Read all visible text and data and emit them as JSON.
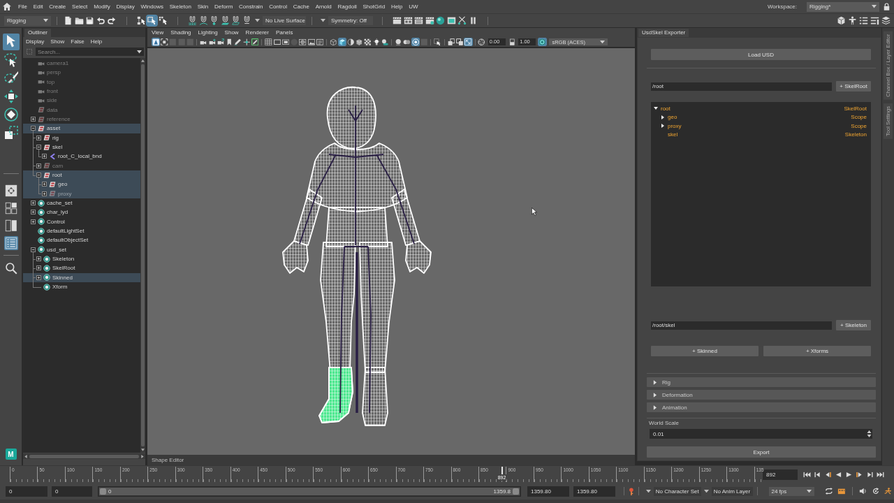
{
  "menu_bar": {
    "items": [
      "File",
      "Edit",
      "Create",
      "Select",
      "Modify",
      "Display",
      "Windows",
      "Skeleton",
      "Skin",
      "Deform",
      "Constrain",
      "Control",
      "Cache",
      "Arnold",
      "Ragdoll",
      "ShotGrid",
      "Help",
      "UW"
    ],
    "workspace_label": "Workspace:",
    "workspace": "Rigging*"
  },
  "status_line": {
    "menu_set": "Rigging",
    "file_tools": [
      {
        "kind": "file",
        "on": false
      },
      {
        "kind": "folder",
        "on": false
      },
      {
        "kind": "save",
        "on": false
      },
      {
        "kind": "undo",
        "on": false
      },
      {
        "kind": "redo",
        "on": false
      }
    ],
    "select_modes": [
      {
        "kind": "hierarchy",
        "on": false
      },
      {
        "kind": "object",
        "on": true
      },
      {
        "kind": "component",
        "on": false
      }
    ],
    "snap_tools": [
      {
        "kind": "snapgrid",
        "on": false
      },
      {
        "kind": "snapcurve",
        "on": false
      },
      {
        "kind": "snappoint",
        "on": false
      },
      {
        "kind": "snapplane",
        "on": false
      },
      {
        "kind": "snaplive",
        "on": false
      },
      {
        "kind": "magnet",
        "on": false
      }
    ],
    "live_surface": "No Live Surface",
    "symmetry": "Symmetry: Off",
    "render_tools": [
      {
        "kind": "clapper",
        "on": false
      },
      {
        "kind": "sequence",
        "on": false
      },
      {
        "kind": "ipr",
        "on": false
      },
      {
        "kind": "rendersettings",
        "on": false
      },
      {
        "kind": "sphere",
        "on": false
      },
      {
        "kind": "renderview",
        "on": false
      },
      {
        "kind": "scissors",
        "on": false
      },
      {
        "kind": "pause",
        "on": false
      }
    ],
    "panel_tools": [
      {
        "kind": "toolkit"
      },
      {
        "kind": "figure"
      },
      {
        "kind": "outline"
      },
      {
        "kind": "editor"
      },
      {
        "kind": "layers"
      }
    ]
  },
  "toolbox": {
    "tools": [
      {
        "kind": "select",
        "selected": true
      },
      {
        "kind": "lasso",
        "selected": false
      },
      {
        "kind": "paint",
        "selected": false
      },
      {
        "kind": "move",
        "selected": false
      },
      {
        "kind": "rotate",
        "selected": false
      },
      {
        "kind": "scale",
        "selected": false
      }
    ],
    "layouts": [
      {
        "kind": "single",
        "selected": false
      },
      {
        "kind": "quad",
        "selected": false
      },
      {
        "kind": "split",
        "selected": false
      },
      {
        "kind": "outlinerlayout",
        "selected": true
      }
    ],
    "badge": "M"
  },
  "outliner": {
    "tab": "Outliner",
    "menus": [
      "Display",
      "Show",
      "False",
      "Help"
    ],
    "search": {
      "placeholder": "Search..."
    },
    "items": [
      {
        "label": "camera1",
        "kind": "camera",
        "hidden": true,
        "selected": false
      },
      {
        "label": "persp",
        "kind": "camera",
        "hidden": true,
        "selected": false
      },
      {
        "label": "top",
        "kind": "camera",
        "hidden": true,
        "selected": false
      },
      {
        "label": "front",
        "kind": "camera",
        "hidden": true,
        "selected": false
      },
      {
        "label": "side",
        "kind": "camera",
        "hidden": true,
        "selected": false
      },
      {
        "label": "data",
        "kind": "group",
        "hidden": true,
        "selected": false
      },
      {
        "label": "reference",
        "kind": "group",
        "hidden": true,
        "selected": false,
        "expanded": false
      },
      {
        "label": "asset",
        "kind": "group",
        "hidden": false,
        "selected": true,
        "expanded": true,
        "children": [
          {
            "label": "rig",
            "kind": "group",
            "hidden": false,
            "selected": false,
            "expanded": false
          },
          {
            "label": "skel",
            "kind": "group",
            "hidden": false,
            "selected": false,
            "expanded": true,
            "children": [
              {
                "label": "root_C_local_bnd",
                "kind": "joint",
                "hidden": false,
                "selected": false,
                "expanded": false
              }
            ]
          },
          {
            "label": "cam",
            "kind": "group",
            "hidden": true,
            "selected": false,
            "expanded": false
          },
          {
            "label": "root",
            "kind": "group",
            "hidden": false,
            "selected": true,
            "expanded": true,
            "children": [
              {
                "label": "geo",
                "kind": "group",
                "hidden": false,
                "selected": true,
                "expanded": false
              },
              {
                "label": "proxy",
                "kind": "group",
                "hidden": true,
                "selected": true,
                "expanded": false
              }
            ]
          }
        ]
      },
      {
        "label": "cache_set",
        "kind": "set",
        "hidden": false,
        "selected": false,
        "expanded": false
      },
      {
        "label": "char_lyd",
        "kind": "set",
        "hidden": false,
        "selected": false,
        "expanded": false
      },
      {
        "label": "Control",
        "kind": "set",
        "hidden": false,
        "selected": false,
        "expanded": false
      },
      {
        "label": "defaultLightSet",
        "kind": "set",
        "hidden": false,
        "selected": false
      },
      {
        "label": "defaultObjectSet",
        "kind": "set",
        "hidden": false,
        "selected": false
      },
      {
        "label": "usd_set",
        "kind": "set",
        "hidden": false,
        "selected": false,
        "expanded": true,
        "children": [
          {
            "label": "Skeleton",
            "kind": "set",
            "hidden": false,
            "selected": false,
            "expanded": false
          },
          {
            "label": "SkelRoot",
            "kind": "set",
            "hidden": false,
            "selected": false,
            "expanded": false
          },
          {
            "label": "Skinned",
            "kind": "set",
            "hidden": false,
            "selected": true,
            "expanded": false
          },
          {
            "label": "Xform",
            "kind": "set",
            "hidden": false,
            "selected": false
          }
        ]
      }
    ]
  },
  "viewport": {
    "menus": [
      "View",
      "Shading",
      "Lighting",
      "Show",
      "Renderer",
      "Panels"
    ],
    "tool_groups": [
      [
        {
          "kind": "tile",
          "on": true,
          "disabled": false
        },
        {
          "kind": "framecorners",
          "on": false,
          "disabled": false
        },
        {
          "kind": "square",
          "on": false,
          "disabled": true
        },
        {
          "kind": "square",
          "on": false,
          "disabled": true
        },
        {
          "kind": "square",
          "on": false,
          "disabled": true
        }
      ],
      [
        {
          "kind": "camera",
          "on": false,
          "disabled": false
        },
        {
          "kind": "cameraplus",
          "on": false,
          "disabled": false
        },
        {
          "kind": "cameraarrow",
          "on": false,
          "disabled": false
        },
        {
          "kind": "bookmark",
          "on": false,
          "disabled": false
        },
        {
          "kind": "pen",
          "on": false,
          "disabled": false
        },
        {
          "kind": "axes",
          "on": false,
          "disabled": false
        },
        {
          "kind": "pencil",
          "on": false,
          "disabled": false
        }
      ],
      [
        {
          "kind": "grid",
          "on": false,
          "disabled": false
        },
        {
          "kind": "filmgate",
          "on": false,
          "disabled": false
        },
        {
          "kind": "resgate",
          "on": false,
          "disabled": false
        },
        {
          "kind": "circle",
          "on": false,
          "disabled": true
        },
        {
          "kind": "fieldchart",
          "on": false,
          "disabled": false
        },
        {
          "kind": "imageplane",
          "on": false,
          "disabled": false
        },
        {
          "kind": "titlesafe",
          "on": false,
          "disabled": false
        }
      ],
      [
        {
          "kind": "wirecube",
          "on": false,
          "disabled": false
        },
        {
          "kind": "shadedcube",
          "on": true,
          "disabled": false
        },
        {
          "kind": "halfcircle",
          "on": false,
          "disabled": false
        },
        {
          "kind": "texcube",
          "on": false,
          "disabled": false
        },
        {
          "kind": "checker",
          "on": false,
          "disabled": false
        },
        {
          "kind": "bulb",
          "on": false,
          "disabled": false
        },
        {
          "kind": "shadow",
          "on": false,
          "disabled": false
        }
      ],
      [
        {
          "kind": "ball",
          "on": false,
          "disabled": false
        },
        {
          "kind": "balls",
          "on": false,
          "disabled": false
        },
        {
          "kind": "target",
          "on": true,
          "disabled": false
        },
        {
          "kind": "square",
          "on": false,
          "disabled": true
        }
      ],
      [
        {
          "kind": "cursorbox",
          "on": false,
          "disabled": false
        }
      ],
      [
        {
          "kind": "stacked",
          "on": false,
          "disabled": false
        },
        {
          "kind": "overlap",
          "on": false,
          "disabled": false
        },
        {
          "kind": "resize",
          "on": true,
          "disabled": false
        }
      ]
    ],
    "exposure": "0.00",
    "gamma": "1.00",
    "color_space": "sRGB (ACES)"
  },
  "shape_editor_tab": "Shape Editor",
  "exporter": {
    "tab": "UsdSkel Exporter",
    "load_button": "Load USD",
    "root_path": "/root",
    "skelroot_button": "+ SkelRoot",
    "prims": [
      {
        "name": "root",
        "type": "SkelRoot",
        "expanded": true,
        "children": [
          {
            "name": "geo",
            "type": "Scope",
            "expanded": false
          },
          {
            "name": "proxy",
            "type": "Scope",
            "expanded": false
          },
          {
            "name": "skel",
            "type": "Skeleton"
          }
        ]
      }
    ],
    "skel_path": "/root/skel",
    "skeleton_button": "+ Skeleton",
    "skinned_button": "+ Skinned",
    "xforms_button": "+ Xforms",
    "sections": [
      {
        "label": "Rig",
        "expanded": false
      },
      {
        "label": "Deformation",
        "expanded": false
      },
      {
        "label": "Animation",
        "expanded": false
      }
    ],
    "world_scale_label": "World Scale",
    "world_scale": "0.01",
    "export_button": "Export"
  },
  "side_tabs": [
    "Channel Box / Layer Editor",
    "Tool Settings"
  ],
  "time_slider": {
    "ticks": [
      "0",
      "50",
      "100",
      "150",
      "200",
      "250",
      "300",
      "350",
      "400",
      "450",
      "500",
      "550",
      "600",
      "650",
      "700",
      "750",
      "800",
      "850",
      "900",
      "950",
      "1000",
      "1050",
      "1100",
      "1150",
      "1200",
      "1250",
      "1300",
      "135"
    ],
    "current_frame": "892",
    "level": 0.656,
    "frame_field": "892"
  },
  "range_slider": {
    "start": "0",
    "playback_start": "0",
    "range_start": "0",
    "range_end": "1359.8",
    "level": 1,
    "playback_end": "1359.80",
    "end": "1359.80",
    "character_set": "No Character Set",
    "anim_layer": "No Anim Layer",
    "fps": "24 fps"
  }
}
